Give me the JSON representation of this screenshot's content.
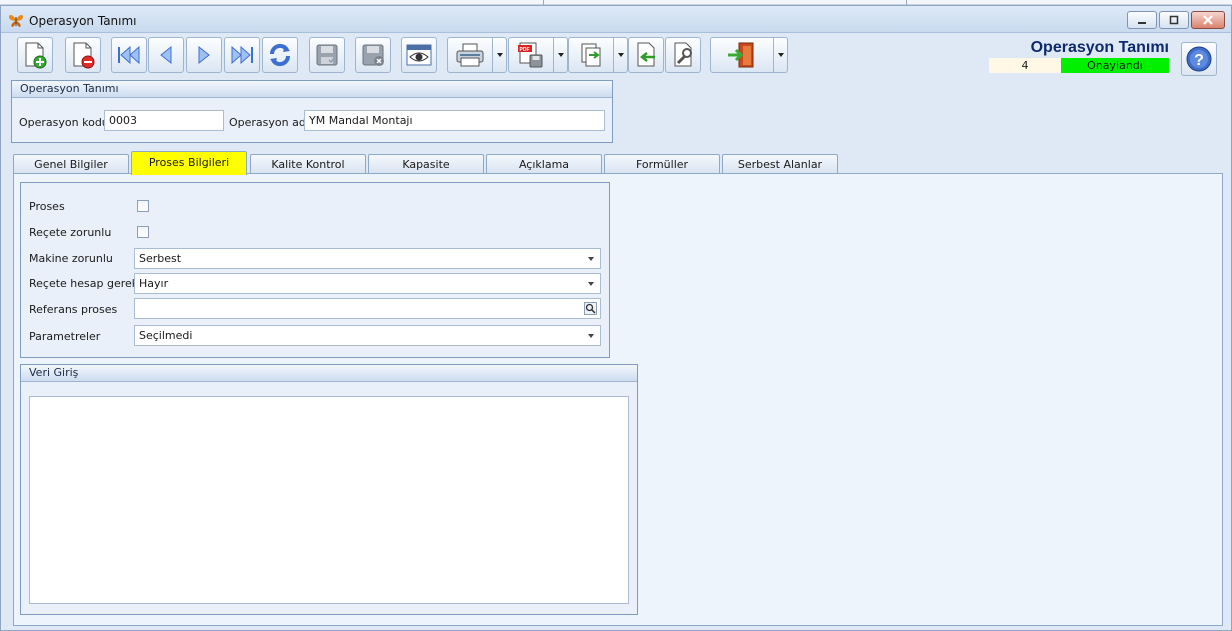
{
  "window": {
    "title": "Operasyon Tanımı"
  },
  "header": {
    "title": "Operasyon Tanımı",
    "record_count": "4",
    "status": "Onaylandı",
    "status_color": "#00f000"
  },
  "toolbar": {
    "buttons": [
      {
        "name": "new",
        "icon": "new-document-icon"
      },
      {
        "name": "delete",
        "icon": "delete-document-icon"
      },
      {
        "name": "first",
        "icon": "first-record-icon"
      },
      {
        "name": "prev",
        "icon": "previous-record-icon"
      },
      {
        "name": "next",
        "icon": "next-record-icon"
      },
      {
        "name": "last",
        "icon": "last-record-icon"
      },
      {
        "name": "refresh",
        "icon": "refresh-icon"
      },
      {
        "name": "save",
        "icon": "save-icon"
      },
      {
        "name": "cancel-save",
        "icon": "save-cancel-icon"
      },
      {
        "name": "preview",
        "icon": "preview-eye-icon"
      },
      {
        "name": "print",
        "icon": "printer-icon"
      },
      {
        "name": "pdf",
        "icon": "pdf-export-icon"
      },
      {
        "name": "export",
        "icon": "export-icon"
      },
      {
        "name": "import",
        "icon": "import-icon"
      },
      {
        "name": "settings",
        "icon": "wrench-icon"
      },
      {
        "name": "exit",
        "icon": "exit-door-icon"
      }
    ]
  },
  "operation_group": {
    "title": "Operasyon Tanımı",
    "code_label": "Operasyon kodu",
    "code_value": "0003",
    "name_label": "Operasyon adı",
    "name_value": "YM Mandal Montajı"
  },
  "tabs": [
    {
      "label": "Genel Bilgiler",
      "active": false
    },
    {
      "label": "Proses Bilgileri",
      "active": true
    },
    {
      "label": "Kalite Kontrol",
      "active": false
    },
    {
      "label": "Kapasite",
      "active": false
    },
    {
      "label": "Açıklama",
      "active": false
    },
    {
      "label": "Formüller",
      "active": false
    },
    {
      "label": "Serbest Alanlar",
      "active": false
    }
  ],
  "process": {
    "proses_label": "Proses",
    "proses_checked": false,
    "recete_zorunlu_label": "Reçete zorunlu",
    "recete_zorunlu_checked": false,
    "makine_zorunlu_label": "Makine zorunlu",
    "makine_zorunlu_value": "Serbest",
    "recete_hesap_label": "Reçete hesap gerekli",
    "recete_hesap_value": "Hayır",
    "referans_label": "Referans proses",
    "referans_value": "",
    "parametreler_label": "Parametreler",
    "parametreler_value": "Seçilmedi"
  },
  "veri_giris": {
    "title": "Veri Giriş",
    "value": ""
  }
}
